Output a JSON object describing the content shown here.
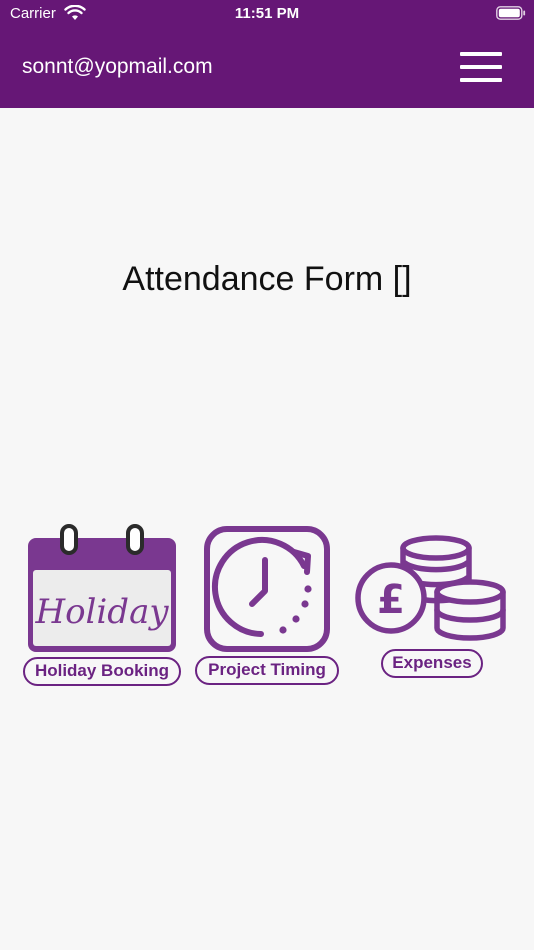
{
  "status_bar": {
    "carrier": "Carrier",
    "time": "11:51 PM"
  },
  "header": {
    "email": "sonnt@yopmail.com",
    "menu_icon": "hamburger-menu-icon"
  },
  "main": {
    "title": "Attendance Form []"
  },
  "tiles": [
    {
      "label": "Holiday Booking",
      "icon": "holiday-calendar-icon",
      "icon_text": "Holiday"
    },
    {
      "label": "Project Timing",
      "icon": "clock-icon"
    },
    {
      "label": "Expenses",
      "icon": "pound-coins-icon"
    }
  ],
  "colors": {
    "header_bg": "#661776",
    "accent": "#6b2382",
    "background": "#f7f7f7"
  }
}
